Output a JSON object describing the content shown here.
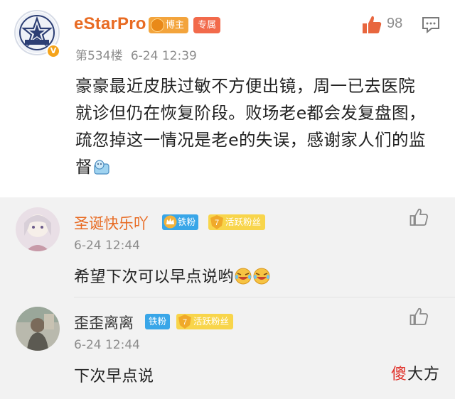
{
  "post": {
    "author": "eStarPro",
    "badges": {
      "rank": "博主",
      "type": "专属"
    },
    "floor": "第534楼",
    "datetime": "6-24 12:39",
    "likes": "98",
    "body": "豪豪最近皮肤过敏不方便出镜，周一已去医院就诊但仍在恢复阶段。败场老e都会发复盘图，疏忽掉这一情况是老e的失误，感谢家人们的监督",
    "body_emoji": "ice-emoji"
  },
  "replies": [
    {
      "name": "圣诞快乐吖",
      "fan_badge": "铁粉",
      "active_badge": "活跃粉丝",
      "active_level": "7",
      "time": "6-24 12:44",
      "text": "希望下次可以早点说哟",
      "emojis": [
        "laugh-cry-emoji",
        "laugh-cry-emoji"
      ]
    },
    {
      "name": "歪歪离离",
      "fan_badge": "铁粉",
      "active_badge": "活跃粉丝",
      "active_level": "7",
      "time": "6-24 12:44",
      "text": "下次早点说"
    }
  ],
  "watermark": {
    "accent": "傻",
    "rest": "大方"
  },
  "colors": {
    "username": "#e86b23",
    "badge_gold": "#f3a43c",
    "badge_red": "#f26a4b",
    "badge_blue": "#39a6e8",
    "badge_yellow": "#f8d54b",
    "reply_bg": "#f2f2f2"
  }
}
